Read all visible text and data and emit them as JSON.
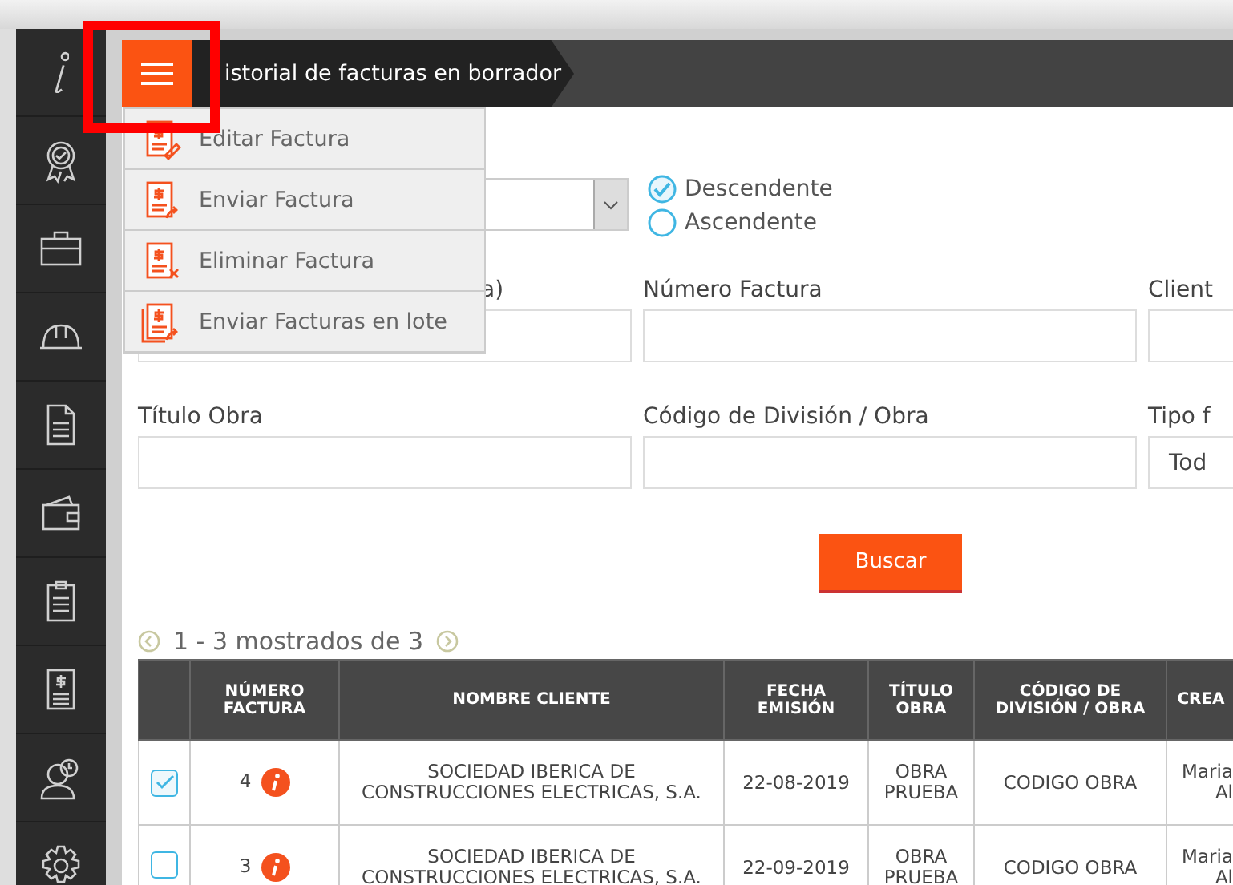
{
  "header": {
    "title": "istorial de facturas en borrador"
  },
  "menu": {
    "expanded": true,
    "items": [
      {
        "label": "Editar Factura"
      },
      {
        "label": "Enviar Factura"
      },
      {
        "label": "Eliminar Factura"
      },
      {
        "label": "Enviar Facturas en lote"
      }
    ]
  },
  "sort_order": [
    {
      "label": "Descendente",
      "selected": true
    },
    {
      "label": "Ascendente",
      "selected": false
    }
  ],
  "fields": [
    {
      "label": "a)"
    },
    {
      "label": "Número Factura"
    },
    {
      "label": "Client"
    },
    {
      "label": "Título Obra"
    },
    {
      "label": "Código de División / Obra"
    },
    {
      "label": "Tipo f",
      "value": "Tod"
    }
  ],
  "search_button": "Buscar",
  "pagination": "1 - 3 mostrados de 3",
  "table": {
    "columns": [
      "",
      "NÚMERO FACTURA",
      "NOMBRE CLIENTE",
      "FECHA EMISIÓN",
      "TÍTULO OBRA",
      "CÓDIGO DE DIVISIÓN / OBRA",
      "CREA"
    ],
    "rows": [
      {
        "selected": true,
        "numero": "4",
        "cliente": "SOCIEDAD IBERICA DE CONSTRUCCIONES ELECTRICAS, S.A.",
        "fecha": "22-08-2019",
        "titulo": "OBRA PRUEBA",
        "codigo": "CODIGO OBRA",
        "creador": "Maria Al"
      },
      {
        "selected": false,
        "numero": "3",
        "cliente": "SOCIEDAD IBERICA DE CONSTRUCCIONES ELECTRICAS, S.A.",
        "fecha": "22-09-2019",
        "titulo": "OBRA PRUEBA",
        "codigo": "CODIGO OBRA",
        "creador": "Maria Al"
      }
    ]
  }
}
